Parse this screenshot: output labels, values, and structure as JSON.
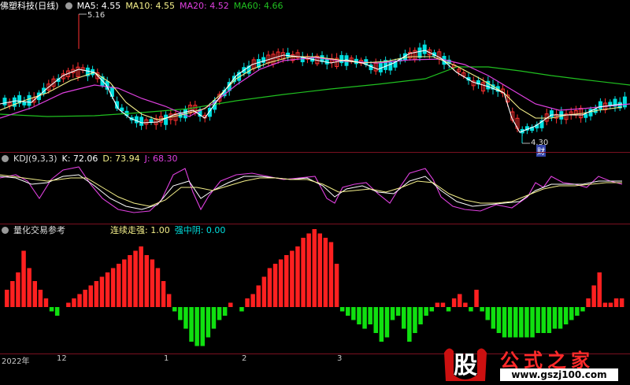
{
  "colors": {
    "ma5": "#ffffff",
    "ma10": "#f5f08a",
    "ma20": "#e040e0",
    "ma60": "#20c020",
    "up": "#ff3030",
    "down": "#00e0e0",
    "k": "#ffffff",
    "d": "#f5f08a",
    "j": "#e040e0",
    "bar_red": "#ff2020",
    "bar_green": "#10e010",
    "orange": "#ff9a20",
    "border": "#7a1020"
  },
  "main": {
    "title": "佛塑科技(日线)",
    "ma5_label": "MA5: 4.55",
    "ma10_label": "MA10: 4.55",
    "ma20_label": "MA20: 4.52",
    "ma60_label": "MA60: 4.66",
    "high_label": "5.16",
    "low_label": "4.30",
    "note_label": "财"
  },
  "kdj": {
    "title": "KDJ(9,3,3)",
    "k_label": "K: 72.06",
    "d_label": "D: 73.94",
    "j_label": "J: 68.30"
  },
  "quant": {
    "title": "量化交易参考",
    "streak_label": "连续走强: 1.00",
    "strong_label": "强中阴: 0.00"
  },
  "xaxis": {
    "ticks": [
      "2022年",
      "12",
      "1",
      "2",
      "3"
    ]
  },
  "watermark": {
    "logo": "股",
    "title": "公式之家",
    "url": "www.gszj100.com"
  },
  "chart_data": [
    {
      "type": "line",
      "title": "佛塑科技(日线)",
      "series": [
        {
          "name": "MA5",
          "value": 4.55
        },
        {
          "name": "MA10",
          "value": 4.55
        },
        {
          "name": "MA20",
          "value": 4.52
        },
        {
          "name": "MA60",
          "value": 4.66
        }
      ],
      "annotations": [
        "5.16",
        "4.30"
      ],
      "ylim": [
        4.2,
        5.2
      ]
    },
    {
      "type": "line",
      "title": "KDJ(9,3,3)",
      "series": [
        {
          "name": "K",
          "value": 72.06
        },
        {
          "name": "D",
          "value": 73.94
        },
        {
          "name": "J",
          "value": 68.3
        }
      ]
    },
    {
      "type": "bar",
      "title": "量化交易参考",
      "series": [
        {
          "name": "连续走强",
          "value": 1.0
        },
        {
          "name": "强中阴",
          "value": 0.0
        }
      ],
      "values": [
        4,
        6,
        8,
        13,
        9,
        6,
        4,
        2,
        -1,
        -2,
        0,
        1,
        2,
        3,
        4,
        5,
        6,
        7,
        8,
        9,
        10,
        11,
        12,
        13,
        14,
        12,
        11,
        9,
        6,
        3,
        -1,
        -3,
        -5,
        -8,
        -9,
        -9,
        -7,
        -5,
        -3,
        -2,
        1,
        0,
        -1,
        2,
        3,
        5,
        7,
        9,
        10,
        11,
        12,
        13,
        14,
        16,
        17,
        18,
        17,
        16,
        15,
        10,
        -1,
        -2,
        -3,
        -4,
        -5,
        -4,
        -6,
        -8,
        -7,
        -3,
        -2,
        -5,
        -8,
        -6,
        -4,
        -2,
        -1,
        1,
        1,
        -1,
        2,
        3,
        1,
        -1,
        4,
        -1,
        -3,
        -5,
        -6,
        -7,
        -7,
        -7,
        -7,
        -7,
        -7,
        -6,
        -6,
        -6,
        -5,
        -5,
        -4,
        -3,
        -2,
        -1,
        2,
        5,
        8,
        1,
        1,
        2,
        2
      ]
    }
  ]
}
